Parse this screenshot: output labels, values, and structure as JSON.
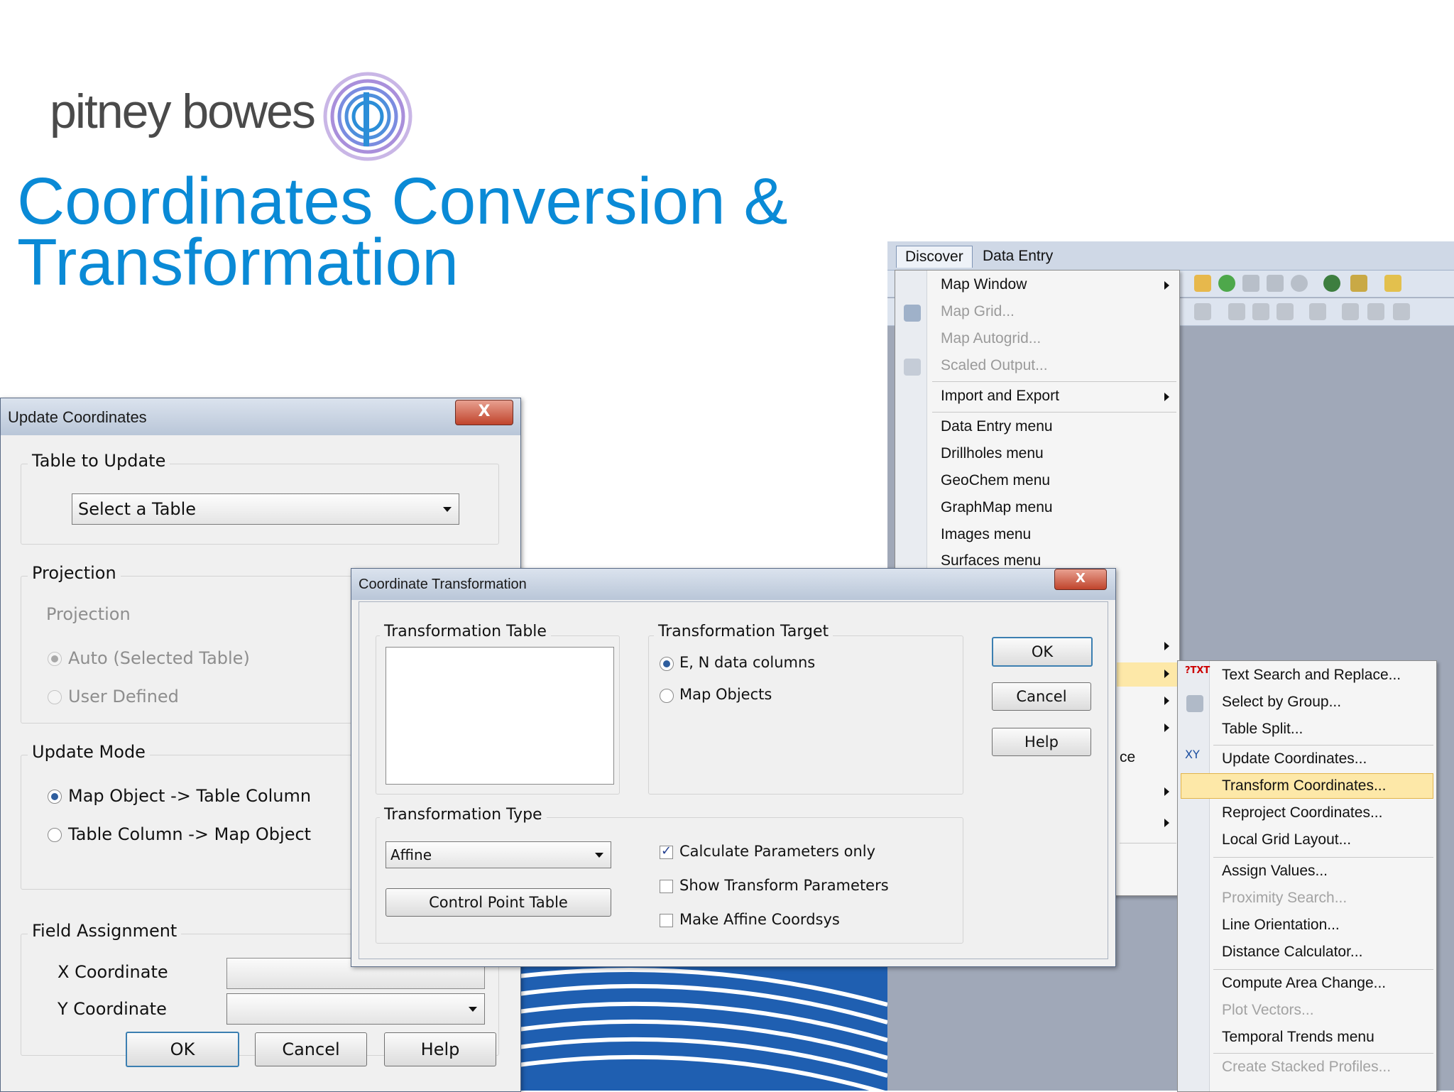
{
  "slide": {
    "logo_text": "pitney bowes",
    "title_line1": "Coordinates Conversion &",
    "title_line2": "Transformation"
  },
  "menubar": {
    "items": [
      "Discover",
      "Data Entry"
    ]
  },
  "discover_menu": {
    "items": [
      {
        "label": "Map Window",
        "disabled": false,
        "submenu": true
      },
      {
        "label": "Map Grid...",
        "disabled": true
      },
      {
        "label": "Map Autogrid...",
        "disabled": true
      },
      {
        "label": "Scaled Output...",
        "disabled": true
      },
      {
        "label": "Import and Export",
        "disabled": false,
        "submenu": true
      },
      {
        "label": "Data Entry menu",
        "disabled": false
      },
      {
        "label": "Drillholes menu",
        "disabled": false
      },
      {
        "label": "GeoChem menu",
        "disabled": false
      },
      {
        "label": "GraphMap menu",
        "disabled": false
      },
      {
        "label": "Images menu",
        "disabled": false
      },
      {
        "label": "Surfaces menu",
        "disabled": false
      },
      {
        "label": "ce",
        "disabled": false
      }
    ]
  },
  "submenu": {
    "items": [
      {
        "label": "Text Search and Replace...",
        "disabled": false
      },
      {
        "label": "Select by Group...",
        "disabled": false
      },
      {
        "label": "Table Split...",
        "disabled": false
      },
      {
        "label": "Update Coordinates...",
        "disabled": false
      },
      {
        "label": "Transform Coordinates...",
        "disabled": false,
        "highlighted": true
      },
      {
        "label": "Reproject Coordinates...",
        "disabled": false
      },
      {
        "label": "Local Grid Layout...",
        "disabled": false
      },
      {
        "label": "Assign Values...",
        "disabled": false
      },
      {
        "label": "Proximity Search...",
        "disabled": true
      },
      {
        "label": "Line Orientation...",
        "disabled": false
      },
      {
        "label": "Distance Calculator...",
        "disabled": false
      },
      {
        "label": "Compute Area Change...",
        "disabled": false
      },
      {
        "label": "Plot Vectors...",
        "disabled": true
      },
      {
        "label": "Temporal Trends menu",
        "disabled": false
      },
      {
        "label": "Create Stacked Profiles...",
        "disabled": true
      }
    ]
  },
  "update_dialog": {
    "title": "Update Coordinates",
    "close": "X",
    "table_group": "Table to Update",
    "table_select": "Select a Table",
    "projection_group": "Projection",
    "projection_label": "Projection",
    "radio_auto": "Auto (Selected Table)",
    "radio_user": "User Defined",
    "mode_group": "Update Mode",
    "radio_map_to_table": "Map Object -> Table Column",
    "radio_table_to_map": "Table Column -> Map Object",
    "field_group": "Field Assignment",
    "x_label": "X Coordinate",
    "y_label": "Y Coordinate",
    "ok": "OK",
    "cancel": "Cancel",
    "help": "Help"
  },
  "transform_dialog": {
    "title": "Coordinate Transformation",
    "close": "X",
    "table_group": "Transformation Table",
    "target_group": "Transformation Target",
    "radio_en": "E, N data columns",
    "radio_map_objects": "Map Objects",
    "type_group": "Transformation Type",
    "type_select": "Affine",
    "control_point_button": "Control Point Table",
    "check_calc": "Calculate Parameters only",
    "check_show": "Show Transform Parameters",
    "check_affine": "Make Affine Coordsys",
    "ok": "OK",
    "cancel": "Cancel",
    "help": "Help"
  },
  "colors": {
    "title_blue": "#0a8ad6",
    "menu_highlight": "#fde8a8",
    "app_background": "#a0a8b8"
  }
}
